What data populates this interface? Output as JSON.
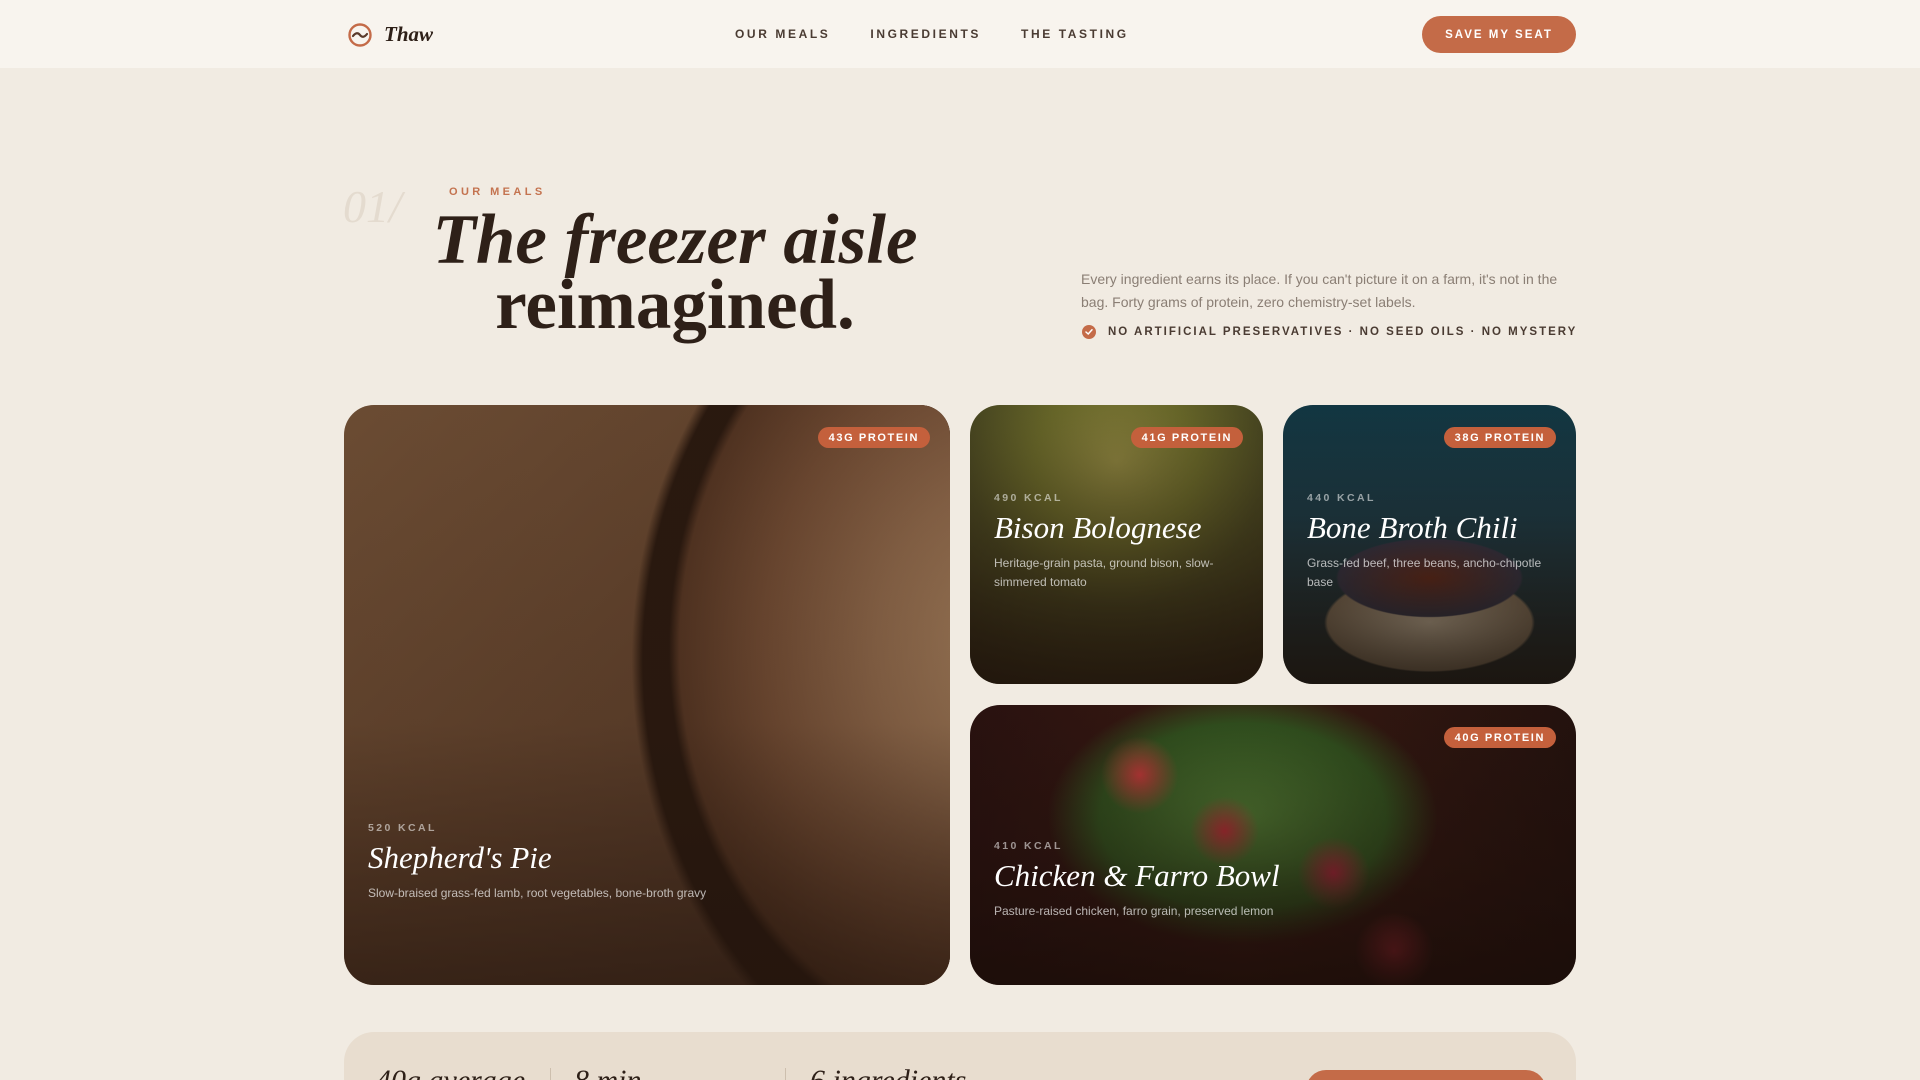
{
  "nav": {
    "brand": "Thaw",
    "links": [
      "OUR MEALS",
      "INGREDIENTS",
      "THE TASTING"
    ],
    "cta": "SAVE MY SEAT"
  },
  "hero": {
    "number": "01/",
    "eyebrow": "OUR MEALS",
    "title_line1": "The freezer aisle",
    "title_line2": "reimagined.",
    "intro": "Every ingredient earns its place. If you can't picture it on a farm, it's not in the bag. Forty grams of protein, zero chemistry-set labels.",
    "claims": "NO ARTIFICIAL PRESERVATIVES · NO SEED OILS · NO MYSTERY"
  },
  "meals": [
    {
      "badge": "43G PROTEIN",
      "kcal": "520 KCAL",
      "name": "Shepherd's Pie",
      "desc": "Slow-braised grass-fed lamb, root vegetables, bone-broth gravy"
    },
    {
      "badge": "41G PROTEIN",
      "kcal": "490 KCAL",
      "name": "Bison Bolognese",
      "desc": "Heritage-grain pasta, ground bison, slow-simmered tomato"
    },
    {
      "badge": "38G PROTEIN",
      "kcal": "440 KCAL",
      "name": "Bone Broth Chili",
      "desc": "Grass-fed beef, three beans, ancho-chipotle base"
    },
    {
      "badge": "40G PROTEIN",
      "kcal": "410 KCAL",
      "name": "Chicken & Farro Bowl",
      "desc": "Pasture-raised chicken, farro grain, preserved lemon"
    }
  ],
  "stats": [
    "40g average",
    "8 min",
    "6 ingredients"
  ],
  "colors": {
    "accent": "#c46b48",
    "background": "#f1ebe2",
    "ink": "#2e2018"
  }
}
